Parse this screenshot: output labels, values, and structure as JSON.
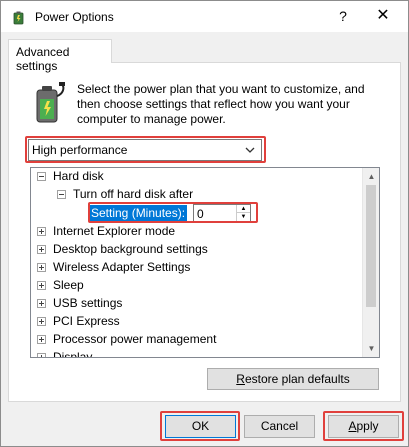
{
  "window": {
    "title": "Power Options",
    "help_glyph": "?",
    "close_glyph": "✕"
  },
  "tab": {
    "label": "Advanced settings"
  },
  "description": "Select the power plan that you want to customize, and then choose settings that reflect how you want your computer to manage power.",
  "plan": {
    "selected": "High performance"
  },
  "tree": {
    "items": [
      {
        "label": "Hard disk",
        "expanded": true
      },
      {
        "label": "Turn off hard disk after",
        "expanded": true
      },
      {
        "label": "Internet Explorer mode"
      },
      {
        "label": "Desktop background settings"
      },
      {
        "label": "Wireless Adapter Settings"
      },
      {
        "label": "Sleep"
      },
      {
        "label": "USB settings"
      },
      {
        "label": "PCI Express"
      },
      {
        "label": "Processor power management"
      },
      {
        "label": "Display"
      }
    ],
    "setting": {
      "label": "Setting (Minutes):",
      "value": "0"
    }
  },
  "buttons": {
    "restore_accel": "R",
    "restore_rest": "estore plan defaults",
    "ok": "OK",
    "cancel": "Cancel",
    "apply_accel": "A",
    "apply_rest": "pply"
  },
  "colors": {
    "highlight_box": "#e0403c",
    "selection": "#0078d7"
  }
}
